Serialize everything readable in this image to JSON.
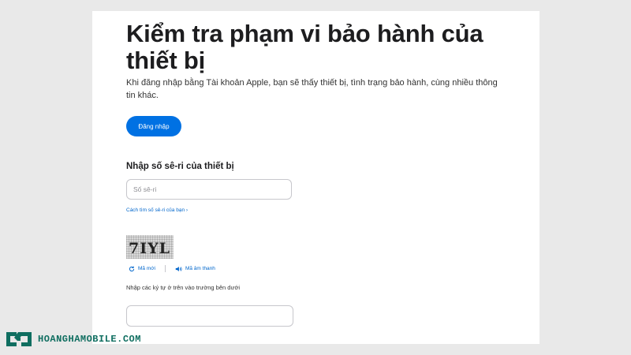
{
  "page": {
    "title": "Kiểm tra phạm vi bảo hành của thiết bị",
    "subtitle": "Khi đăng nhập bằng Tài khoản Apple, bạn sẽ thấy thiết bị, tình trạng bảo hành, cùng nhiều thông tin khác.",
    "signin_label": "Đăng nhập"
  },
  "serial": {
    "heading": "Nhập số sê-ri của thiết bị",
    "placeholder": "Số sê-ri",
    "value": "",
    "find_link": "Cách tìm số sê-ri của bạn ›"
  },
  "captcha": {
    "image_text": "7IYL",
    "new_code_label": "Mã mới",
    "audio_label": "Mã âm thanh",
    "input_label": "Nhập các ký tự ở trên vào trường bên dưới",
    "input_value": ""
  },
  "brand": {
    "name": "HOANGHAMOBILE.COM",
    "color": "#0f6e60"
  },
  "colors": {
    "accent": "#0071e3",
    "link": "#0066cc",
    "background": "#e9e9e9"
  },
  "icons": [
    "refresh-icon",
    "speaker-icon",
    "hoanghamobile-logo"
  ]
}
